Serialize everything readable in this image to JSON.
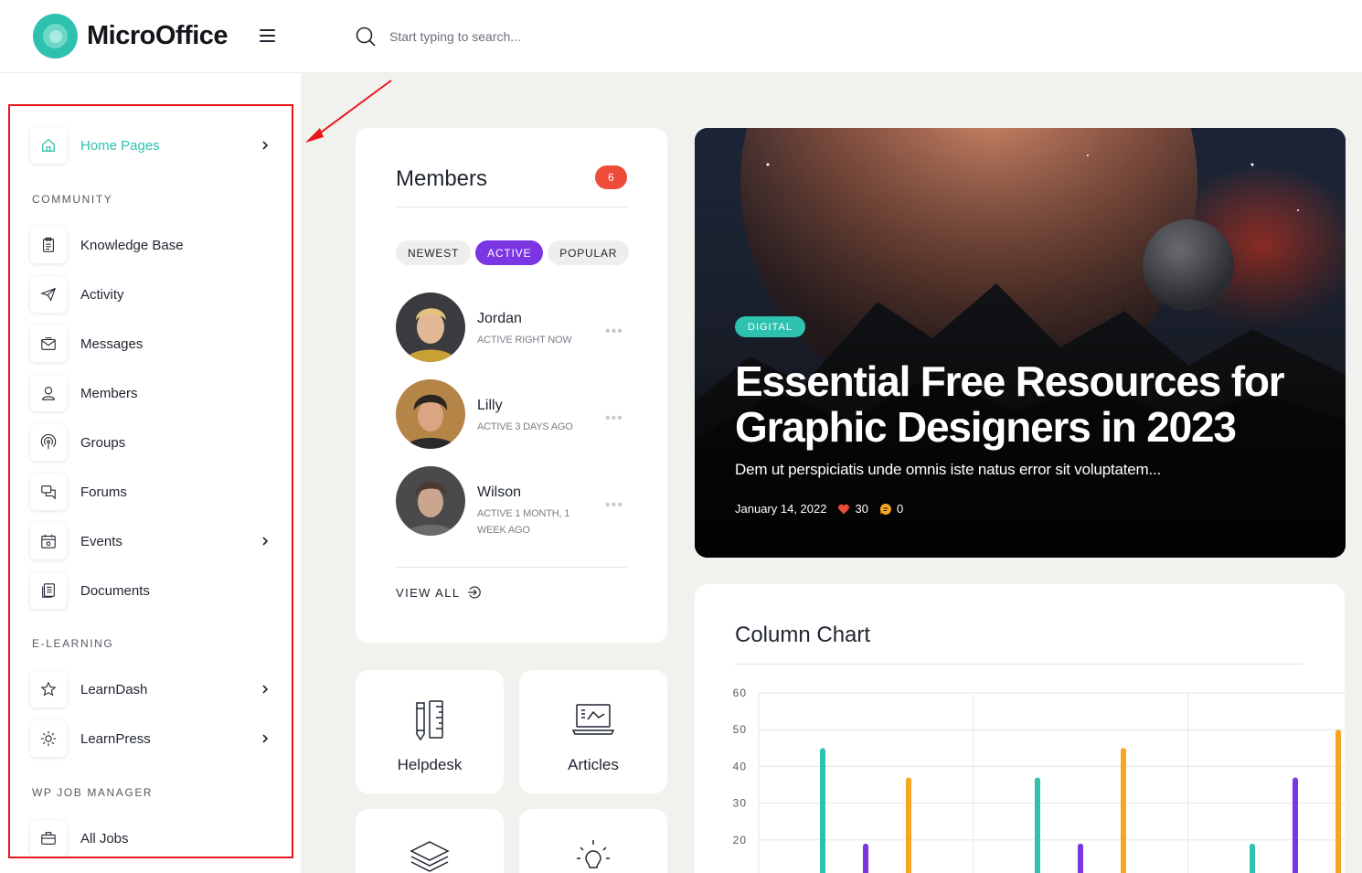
{
  "header": {
    "logo_text": "MicroOffice",
    "search_placeholder": "Start typing to search..."
  },
  "sidebar": {
    "home": {
      "label": "Home Pages",
      "icon": "home-icon"
    },
    "sections": {
      "community": "COMMUNITY",
      "elearning": "E-LEARNING",
      "wpjob": "WP JOB MANAGER"
    },
    "items": [
      {
        "label": "Knowledge Base",
        "icon": "clipboard-icon"
      },
      {
        "label": "Activity",
        "icon": "paper-plane-icon"
      },
      {
        "label": "Messages",
        "icon": "envelope-icon"
      },
      {
        "label": "Members",
        "icon": "user-icon"
      },
      {
        "label": "Groups",
        "icon": "signal-icon"
      },
      {
        "label": "Forums",
        "icon": "chat-icon"
      },
      {
        "label": "Events",
        "icon": "calendar-icon"
      },
      {
        "label": "Documents",
        "icon": "document-icon"
      },
      {
        "label": "LearnDash",
        "icon": "star-icon"
      },
      {
        "label": "LearnPress",
        "icon": "sun-icon"
      },
      {
        "label": "All Jobs",
        "icon": "briefcase-icon"
      }
    ]
  },
  "members_card": {
    "title": "Members",
    "count": "6",
    "tabs": [
      "NEWEST",
      "ACTIVE",
      "POPULAR"
    ],
    "active_tab": "ACTIVE",
    "members": [
      {
        "name": "Jordan",
        "status": "ACTIVE RIGHT NOW"
      },
      {
        "name": "Lilly",
        "status": "ACTIVE 3 DAYS AGO"
      },
      {
        "name": "Wilson",
        "status": "ACTIVE 1 MONTH, 1 WEEK AGO"
      }
    ],
    "view_all": "VIEW ALL"
  },
  "tiles": [
    {
      "label": "Helpdesk",
      "icon": "pencil-ruler-icon"
    },
    {
      "label": "Articles",
      "icon": "laptop-chart-icon"
    },
    {
      "label": "",
      "icon": "layers-icon"
    },
    {
      "label": "",
      "icon": "lightbulb-icon"
    }
  ],
  "hero": {
    "category": "DIGITAL",
    "title": "Essential Free Resources for Graphic Designers in 2023",
    "excerpt": "Dem ut perspiciatis unde omnis iste natus error sit voluptatem...",
    "date": "January 14, 2022",
    "likes": "30",
    "comments": "0"
  },
  "colors": {
    "accent": "#2ec1ad",
    "purple": "#7b35e2",
    "orange": "#f6a623",
    "badge_red": "#ef4b3a",
    "highlight_red": "#e8161b"
  },
  "chart_data": {
    "type": "bar",
    "title": "Column Chart",
    "y_ticks": [
      "60",
      "50",
      "40",
      "30",
      "20"
    ],
    "ylim": [
      10,
      60
    ],
    "grid": true,
    "series": [
      {
        "color": "#2ec1ad",
        "values": [
          45,
          37,
          19
        ]
      },
      {
        "color": "#7b35e2",
        "values": [
          19,
          19,
          37
        ]
      },
      {
        "color": "#f6a623",
        "values": [
          37,
          45,
          50
        ]
      }
    ]
  }
}
